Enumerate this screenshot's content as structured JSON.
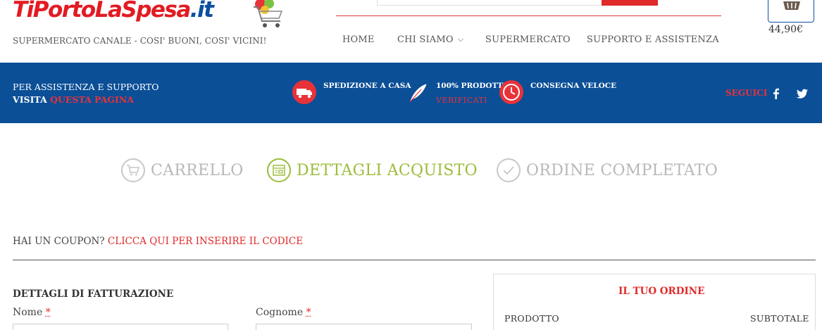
{
  "header": {
    "logo_main": "TiPortoLaSpesa",
    "logo_tld": ".it",
    "tagline": "SUPERMERCATO CANALE - COSI' BUONI, COSI' VICINI!",
    "nav": [
      {
        "label": "HOME"
      },
      {
        "label": "CHI SIAMO"
      },
      {
        "label": "SUPERMERCATO"
      },
      {
        "label": "SUPPORTO E ASSISTENZA"
      }
    ],
    "cart_total": "44,90€",
    "cart_icon": "basket-icon",
    "chevron_icon": "chevron-down-icon"
  },
  "band": {
    "assist_line1": "PER ASSISTENZA E SUPPORTO",
    "assist_visit": "VISITA",
    "assist_link": "QUESTA PAGINA",
    "features": [
      {
        "icon": "truck-icon",
        "label": "SPEDIZIONE A CASA",
        "sub": ""
      },
      {
        "icon": "feather-icon",
        "label": "100% PRODOTTI",
        "sub": "VERIFICATI"
      },
      {
        "icon": "clock-icon",
        "label": "CONSEGNA VELOCE",
        "sub": ""
      }
    ],
    "follow": "SEGUICI",
    "social": [
      "facebook-icon",
      "twitter-icon"
    ],
    "colors": {
      "band": "#0b4f97",
      "accent": "#e8323a"
    }
  },
  "steps": [
    {
      "label": "CARRELLO",
      "icon": "cart-icon",
      "active": false
    },
    {
      "label": "DETTAGLI ACQUISTO",
      "icon": "form-icon",
      "active": true
    },
    {
      "label": "ORDINE COMPLETATO",
      "icon": "check-icon",
      "active": false
    }
  ],
  "coupon": {
    "text": "HAI UN COUPON?",
    "link": "CLICCA QUI PER INSERIRE IL CODICE"
  },
  "billing": {
    "title": "DETTAGLI DI FATTURAZIONE",
    "first_name_label": "Nome",
    "last_name_label": "Cognome",
    "required_mark": "*"
  },
  "order": {
    "title": "IL TUO ORDINE",
    "col_product": "PRODOTTO",
    "col_subtotal": "SUBTOTALE"
  }
}
